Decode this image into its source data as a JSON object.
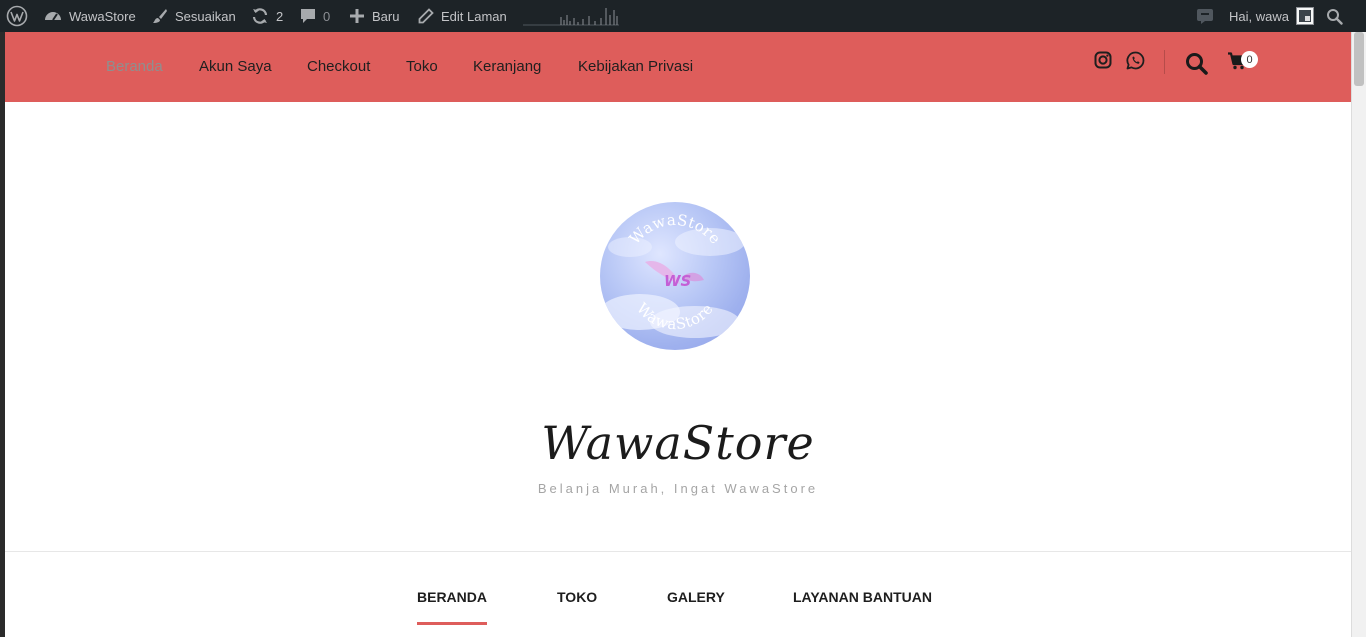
{
  "admin_bar": {
    "site_name": "WawaStore",
    "customize": "Sesuaikan",
    "updates_count": "2",
    "comments_count": "0",
    "new_label": "Baru",
    "edit_page": "Edit Laman",
    "greeting": "Hai, wawa",
    "icons": [
      "wordpress-icon",
      "dashboard-icon",
      "brush-icon",
      "refresh-icon",
      "comment-icon",
      "plus-icon",
      "pencil-icon",
      "chat-icon",
      "avatar",
      "search-icon"
    ]
  },
  "top_nav": {
    "items": [
      {
        "label": "Beranda",
        "active": true
      },
      {
        "label": "Akun Saya"
      },
      {
        "label": "Checkout"
      },
      {
        "label": "Toko"
      },
      {
        "label": "Keranjang"
      },
      {
        "label": "Kebijakan Privasi"
      }
    ],
    "cart_count": "0",
    "icons": [
      "instagram-icon",
      "whatsapp-icon",
      "search-icon",
      "cart-icon"
    ],
    "background": "#de5d5b"
  },
  "logo": {
    "ring_text": "WawaStore",
    "ring_text_bottom": "WawaStore",
    "monogram": "WS"
  },
  "site": {
    "title": "WawaStore",
    "tagline": "Belanja Murah, Ingat WawaStore"
  },
  "secondary_nav": {
    "items": [
      {
        "label": "BERANDA",
        "active": true
      },
      {
        "label": "TOKO"
      },
      {
        "label": "GALERY"
      },
      {
        "label": "LAYANAN BANTUAN"
      }
    ],
    "accent": "#de5d5b"
  }
}
